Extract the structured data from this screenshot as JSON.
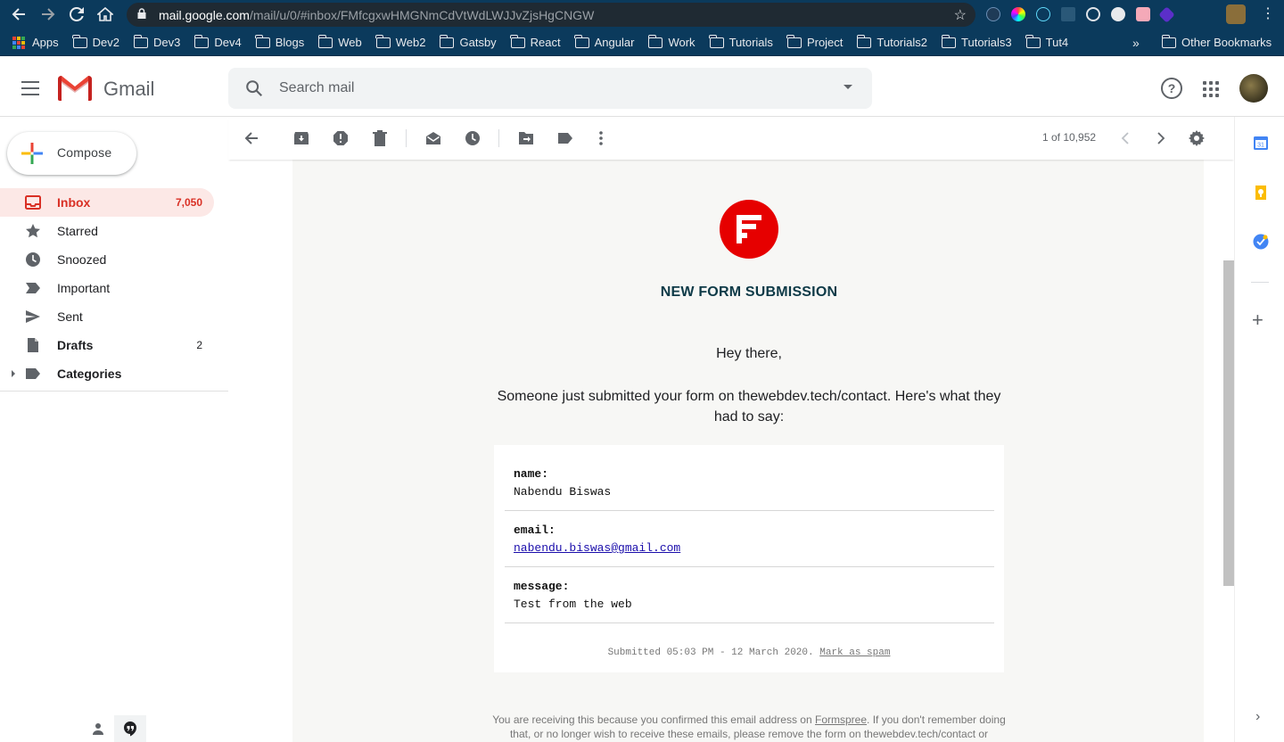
{
  "browser": {
    "url_host": "mail.google.com",
    "url_path": "/mail/u/0/#inbox/FMfcgxwHMGNmCdVtWdLWJJvZjsHgCNGW",
    "bookmarks": [
      "Dev2",
      "Dev3",
      "Dev4",
      "Blogs",
      "Web",
      "Web2",
      "Gatsby",
      "React",
      "Angular",
      "Work",
      "Tutorials",
      "Project",
      "Tutorials2",
      "Tutorials3",
      "Tut4"
    ],
    "apps_label": "Apps",
    "other_bookmarks": "Other Bookmarks",
    "more": "»"
  },
  "header": {
    "app_name": "Gmail",
    "search_placeholder": "Search mail"
  },
  "compose": {
    "label": "Compose"
  },
  "nav": [
    {
      "label": "Inbox",
      "count": "7,050",
      "icon": "inbox-icon"
    },
    {
      "label": "Starred",
      "count": "",
      "icon": "star-icon"
    },
    {
      "label": "Snoozed",
      "count": "",
      "icon": "clock-icon"
    },
    {
      "label": "Important",
      "count": "",
      "icon": "important-icon"
    },
    {
      "label": "Sent",
      "count": "",
      "icon": "send-icon"
    },
    {
      "label": "Drafts",
      "count": "2",
      "icon": "draft-icon"
    },
    {
      "label": "Categories",
      "count": "",
      "icon": "label-icon"
    }
  ],
  "toolbar": {
    "pager": "1 of 10,952",
    "icons": [
      "back-arrow-icon",
      "archive-icon",
      "report-spam-icon",
      "delete-icon",
      "mark-unread-icon",
      "snooze-icon",
      "move-to-icon",
      "labels-icon",
      "more-vert-icon",
      "prev-icon",
      "next-icon",
      "settings-gear-icon"
    ]
  },
  "email": {
    "title": "NEW FORM SUBMISSION",
    "greeting": "Hey there,",
    "intro": "Someone just submitted your form on thewebdev.tech/contact. Here's what they had to say:",
    "fields": [
      {
        "key": "name:",
        "value": "Nabendu Biswas"
      },
      {
        "key": "email:",
        "value": "nabendu.biswas@gmail.com"
      },
      {
        "key": "message:",
        "value": "Test from the web"
      }
    ],
    "submitted_prefix": "Submitted 05:03 PM - 12 March 2020.",
    "mark_spam": "Mark as spam",
    "footer_part1": "You are receiving this because you confirmed this email address on",
    "footer_link": "Formspree",
    "footer_part2": ". If you don't remember doing that, or no longer wish to receive these emails, please remove the form on thewebdev.tech/contact or"
  },
  "colors": {
    "accent_red": "#d93025",
    "formspree_red": "#e60000",
    "title_teal": "#0e3a47"
  }
}
